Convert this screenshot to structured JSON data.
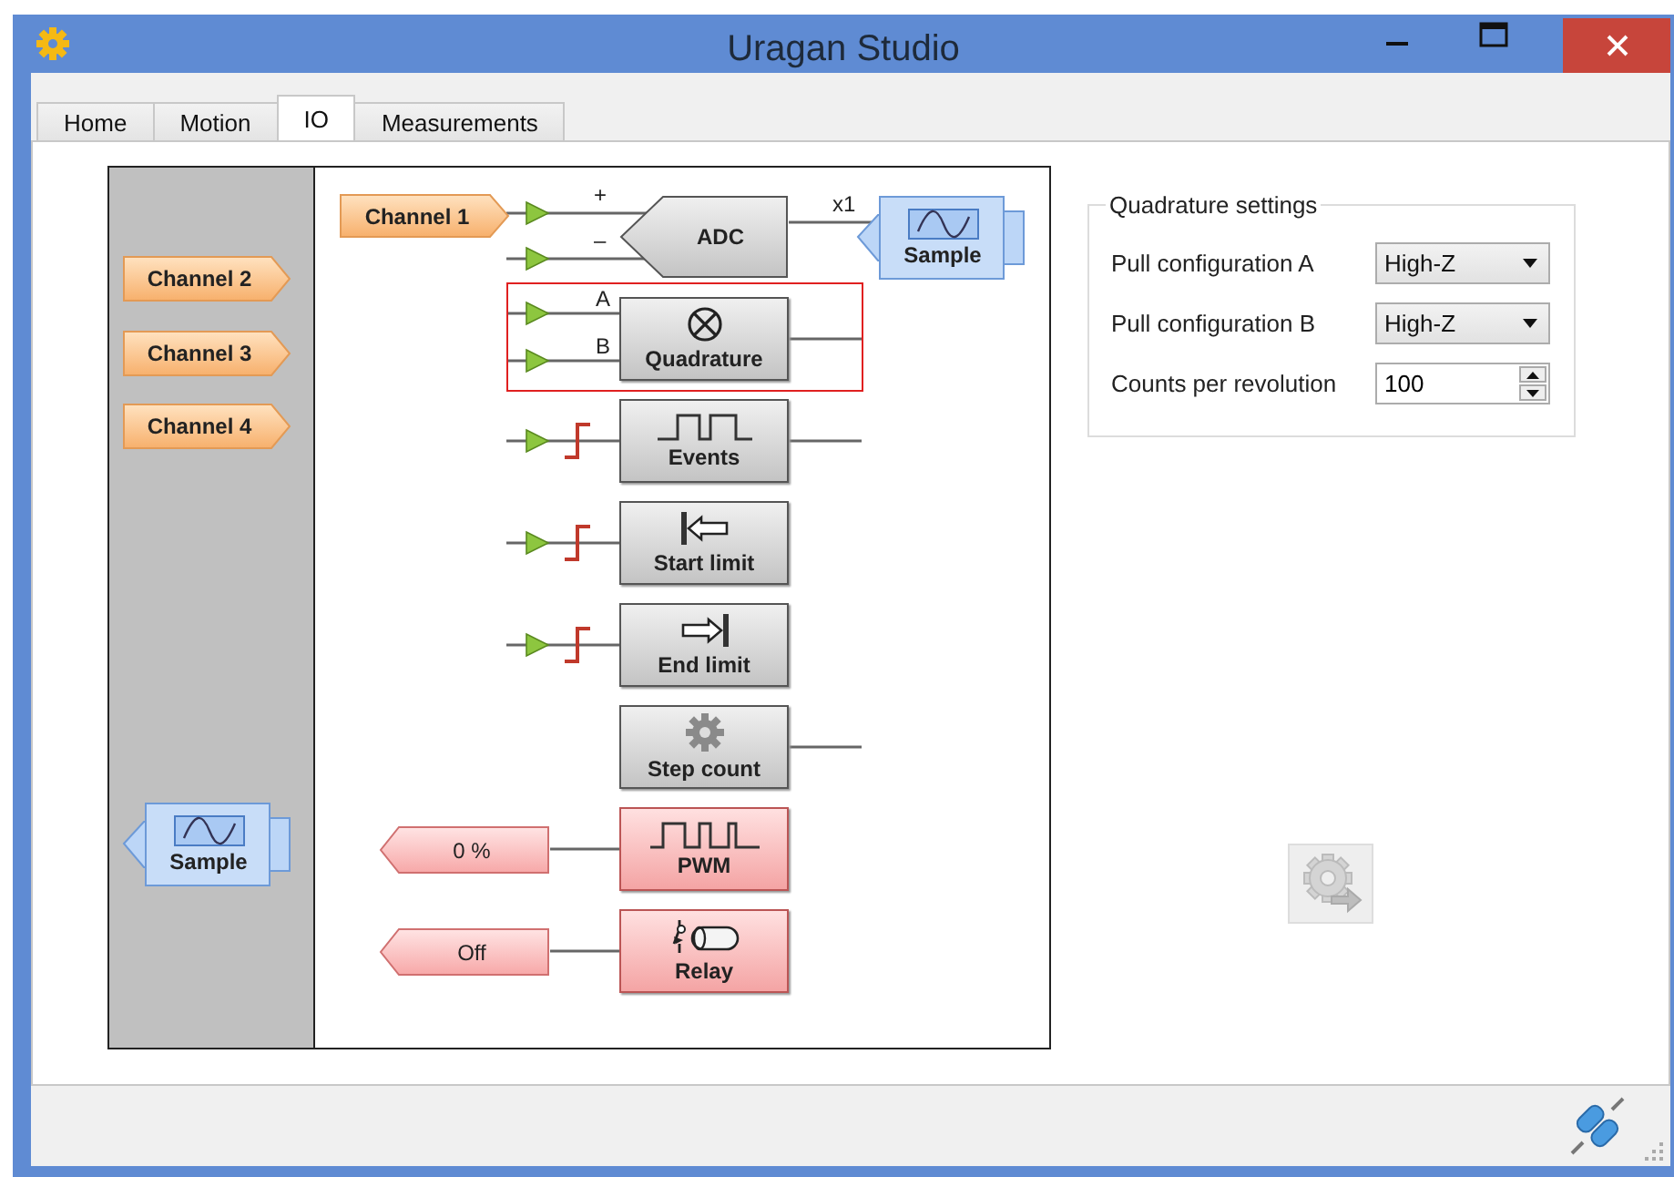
{
  "window": {
    "title": "Uragan Studio"
  },
  "tabs": [
    {
      "label": "Home",
      "selected": false
    },
    {
      "label": "Motion",
      "selected": false
    },
    {
      "label": "IO",
      "selected": true
    },
    {
      "label": "Measurements",
      "selected": false
    }
  ],
  "diagram": {
    "side_ports": [
      {
        "label": "Channel 2"
      },
      {
        "label": "Channel 3"
      },
      {
        "label": "Channel 4"
      }
    ],
    "side_sample": "Sample",
    "input_tag": "Channel 1",
    "blocks": [
      {
        "kind": "adc",
        "label": "ADC",
        "inputs": [
          "+",
          "–"
        ],
        "gain": "x1",
        "output": "Sample",
        "selected": false
      },
      {
        "kind": "quadrature",
        "label": "Quadrature",
        "inputs": [
          "A",
          "B"
        ],
        "selected": true
      },
      {
        "kind": "events",
        "label": "Events",
        "selected": false
      },
      {
        "kind": "start_limit",
        "label": "Start limit",
        "selected": false
      },
      {
        "kind": "end_limit",
        "label": "End limit",
        "selected": false
      },
      {
        "kind": "step_count",
        "label": "Step count",
        "selected": false
      },
      {
        "kind": "pwm",
        "label": "PWM",
        "output": "0 %",
        "selected": false
      },
      {
        "kind": "relay",
        "label": "Relay",
        "output": "Off",
        "selected": false
      }
    ]
  },
  "settings": {
    "title": "Quadrature settings",
    "fields": [
      {
        "kind": "dropdown",
        "label": "Pull configuration A",
        "value": "High-Z"
      },
      {
        "kind": "dropdown",
        "label": "Pull configuration B",
        "value": "High-Z"
      },
      {
        "kind": "spinbox",
        "label": "Counts per revolution",
        "value": "100"
      }
    ]
  }
}
